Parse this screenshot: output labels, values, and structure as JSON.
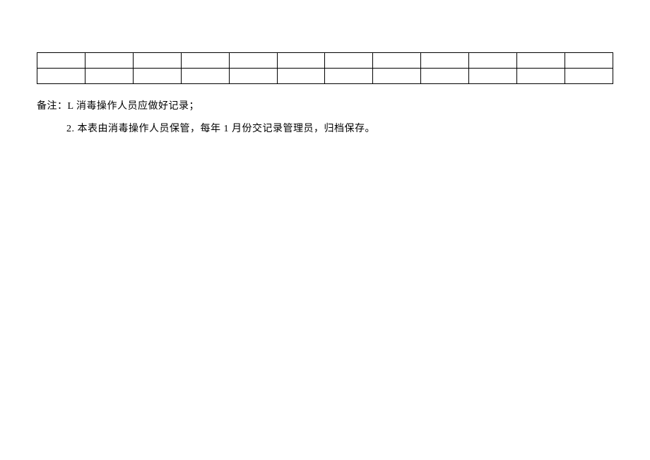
{
  "table": {
    "rows": 2,
    "cols": 12
  },
  "notes": {
    "line1": "备注：L 消毒操作人员应做好记录；",
    "line2": "2. 本表由消毒操作人员保管，每年 1 月份交记录管理员，归档保存。"
  }
}
